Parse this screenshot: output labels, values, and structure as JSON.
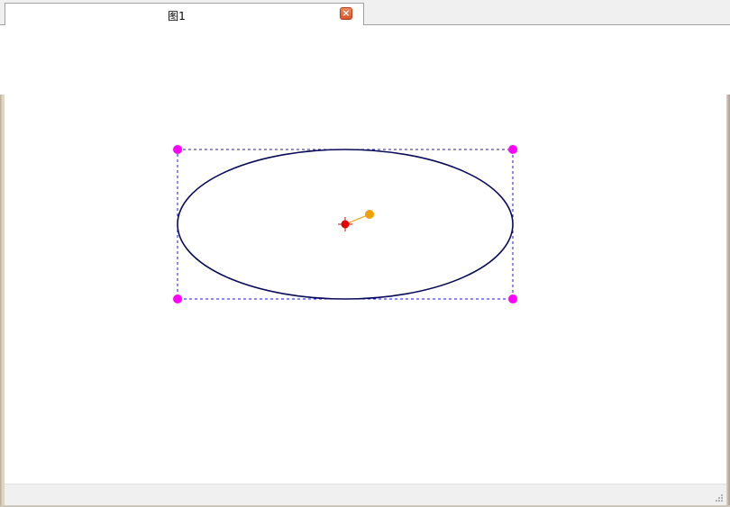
{
  "tab": {
    "title": "图1",
    "close_icon": "close-icon"
  },
  "canvas": {
    "shape": "ellipse",
    "colors": {
      "outline": "#0a0a5a",
      "selection_box": "#1a1ad0",
      "resize_handle": "#ff00ff",
      "center_marker": "#e00000",
      "rotation_handle": "#f0a000"
    }
  }
}
